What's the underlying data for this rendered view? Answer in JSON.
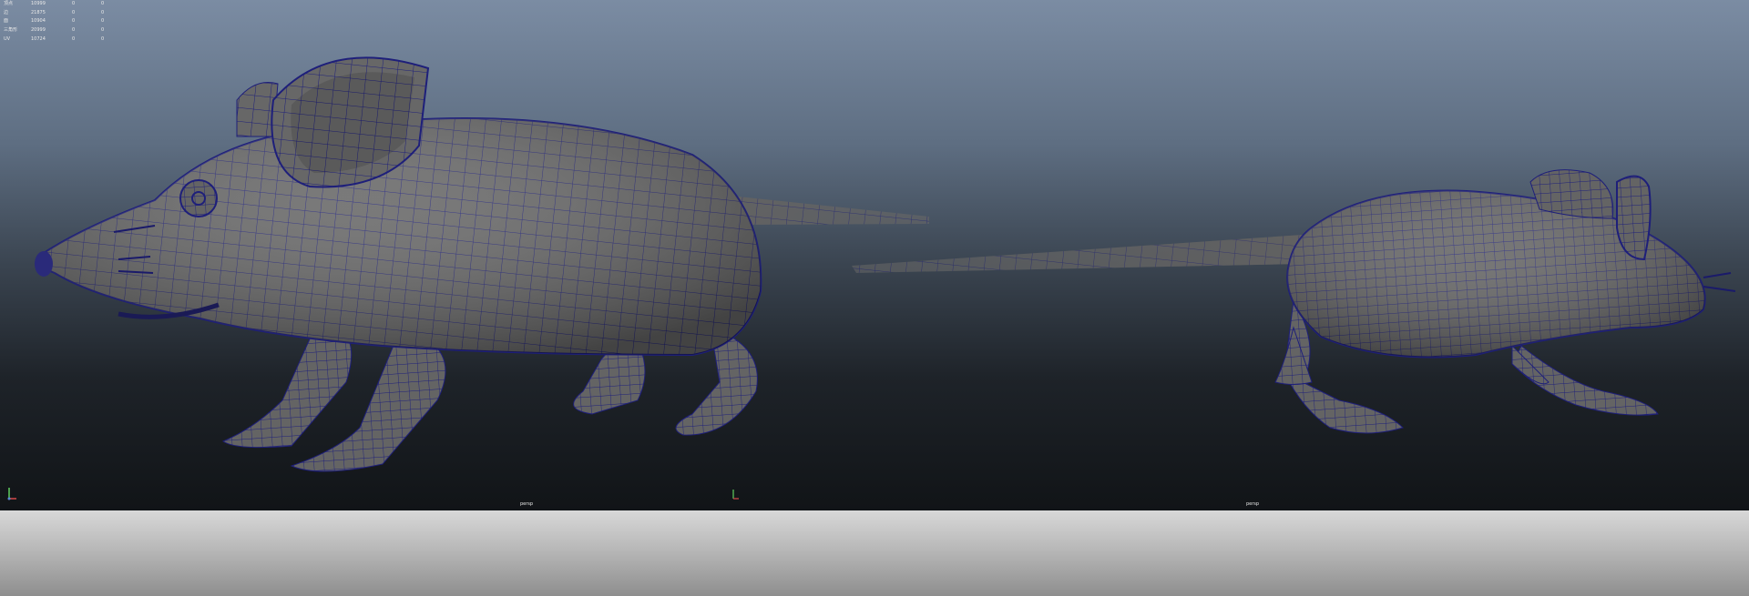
{
  "hud": {
    "rows": [
      {
        "label": "顶点",
        "value": "10999",
        "a": "0",
        "b": "0"
      },
      {
        "label": "边",
        "value": "21875",
        "a": "0",
        "b": "0"
      },
      {
        "label": "面",
        "value": "10904",
        "a": "0",
        "b": "0"
      },
      {
        "label": "三角形",
        "value": "20999",
        "a": "0",
        "b": "0"
      },
      {
        "label": "UV",
        "value": "10724",
        "a": "0",
        "b": "0"
      }
    ]
  },
  "viewports": [
    {
      "camera": "persp"
    },
    {
      "camera": "persp"
    }
  ],
  "colors": {
    "wire": "#1e1f7a",
    "mesh": "#6a6a6a",
    "bg_top": "#7b8ca3",
    "bg_bottom": "#111417"
  },
  "icons": [
    "axis-gizmo-icon",
    "axis-gizmo-icon"
  ]
}
